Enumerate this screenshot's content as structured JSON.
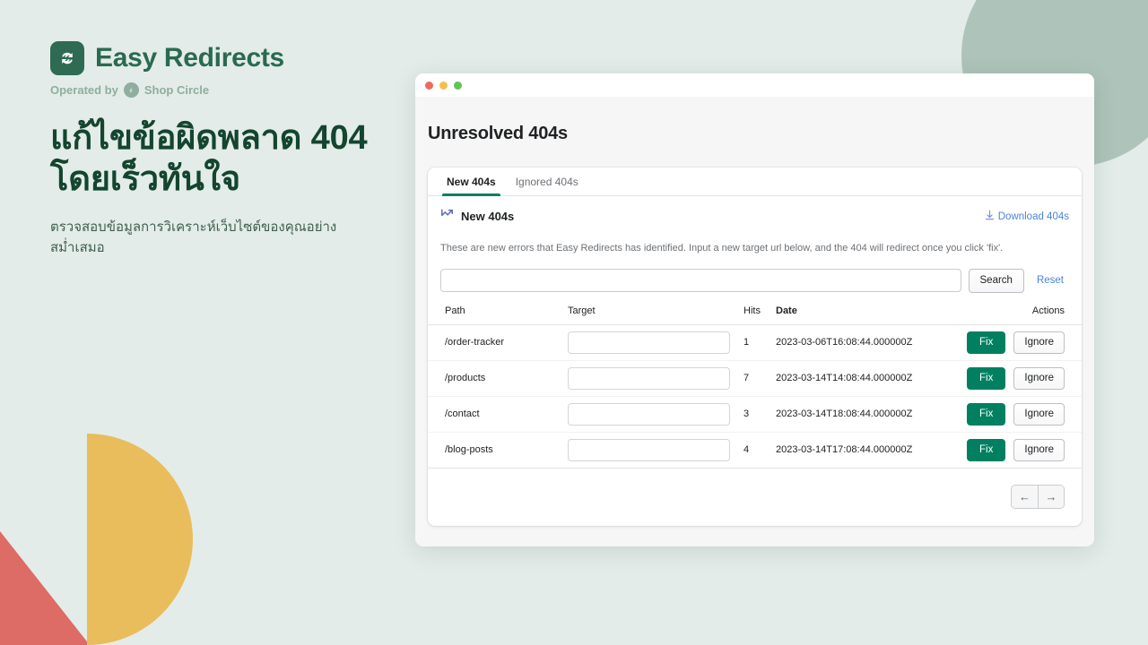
{
  "brand": {
    "name": "Easy Redirects",
    "logo_icon": "refresh-arrows-icon",
    "operated_by_label": "Operated by",
    "partner_name": "Shop Circle",
    "partner_icon": "shop-circle-icon"
  },
  "promo": {
    "headline": "แก้ไขข้อผิดพลาด 404 โดยเร็วทันใจ",
    "subhead": "ตรวจสอบข้อมูลการวิเคราะห์เว็บไซต์ของคุณอย่างสม่ำเสมอ"
  },
  "colors": {
    "background": "#e3ece8",
    "brand_green": "#2a6a50",
    "accent_green": "#008060",
    "link_blue": "#4b84d8",
    "deco_sage": "#aec4bb",
    "deco_red": "#dd6b66",
    "deco_yellow": "#e9bd5c"
  },
  "window": {
    "dots": [
      "close-dot",
      "minimize-dot",
      "maximize-dot"
    ],
    "page_title": "Unresolved 404s"
  },
  "tabs": [
    {
      "label": "New 404s",
      "active": true
    },
    {
      "label": "Ignored 404s",
      "active": false
    }
  ],
  "card": {
    "title": "New 404s",
    "title_icon": "analytics-chart-icon",
    "download_label": "Download 404s",
    "download_icon": "download-arrow-icon",
    "helper_text": "These are new errors that Easy Redirects has identified. Input a new target url below, and the 404 will redirect once you click 'fix'."
  },
  "search": {
    "value": "",
    "placeholder": "",
    "search_label": "Search",
    "reset_label": "Reset"
  },
  "table": {
    "columns": [
      {
        "label": "Path",
        "sorted": false
      },
      {
        "label": "Target",
        "sorted": false
      },
      {
        "label": "Hits",
        "sorted": false
      },
      {
        "label": "Date",
        "sorted": true
      },
      {
        "label": "Actions",
        "sorted": false
      }
    ],
    "rows": [
      {
        "path": "/order-tracker",
        "target": "",
        "hits": "1",
        "date": "2023-03-06T16:08:44.000000Z",
        "fix_label": "Fix",
        "ignore_label": "Ignore"
      },
      {
        "path": "/products",
        "target": "",
        "hits": "7",
        "date": "2023-03-14T14:08:44.000000Z",
        "fix_label": "Fix",
        "ignore_label": "Ignore"
      },
      {
        "path": "/contact",
        "target": "",
        "hits": "3",
        "date": "2023-03-14T18:08:44.000000Z",
        "fix_label": "Fix",
        "ignore_label": "Ignore"
      },
      {
        "path": "/blog-posts",
        "target": "",
        "hits": "4",
        "date": "2023-03-14T17:08:44.000000Z",
        "fix_label": "Fix",
        "ignore_label": "Ignore"
      }
    ]
  },
  "pagination": {
    "prev_label": "←",
    "next_label": "→"
  }
}
